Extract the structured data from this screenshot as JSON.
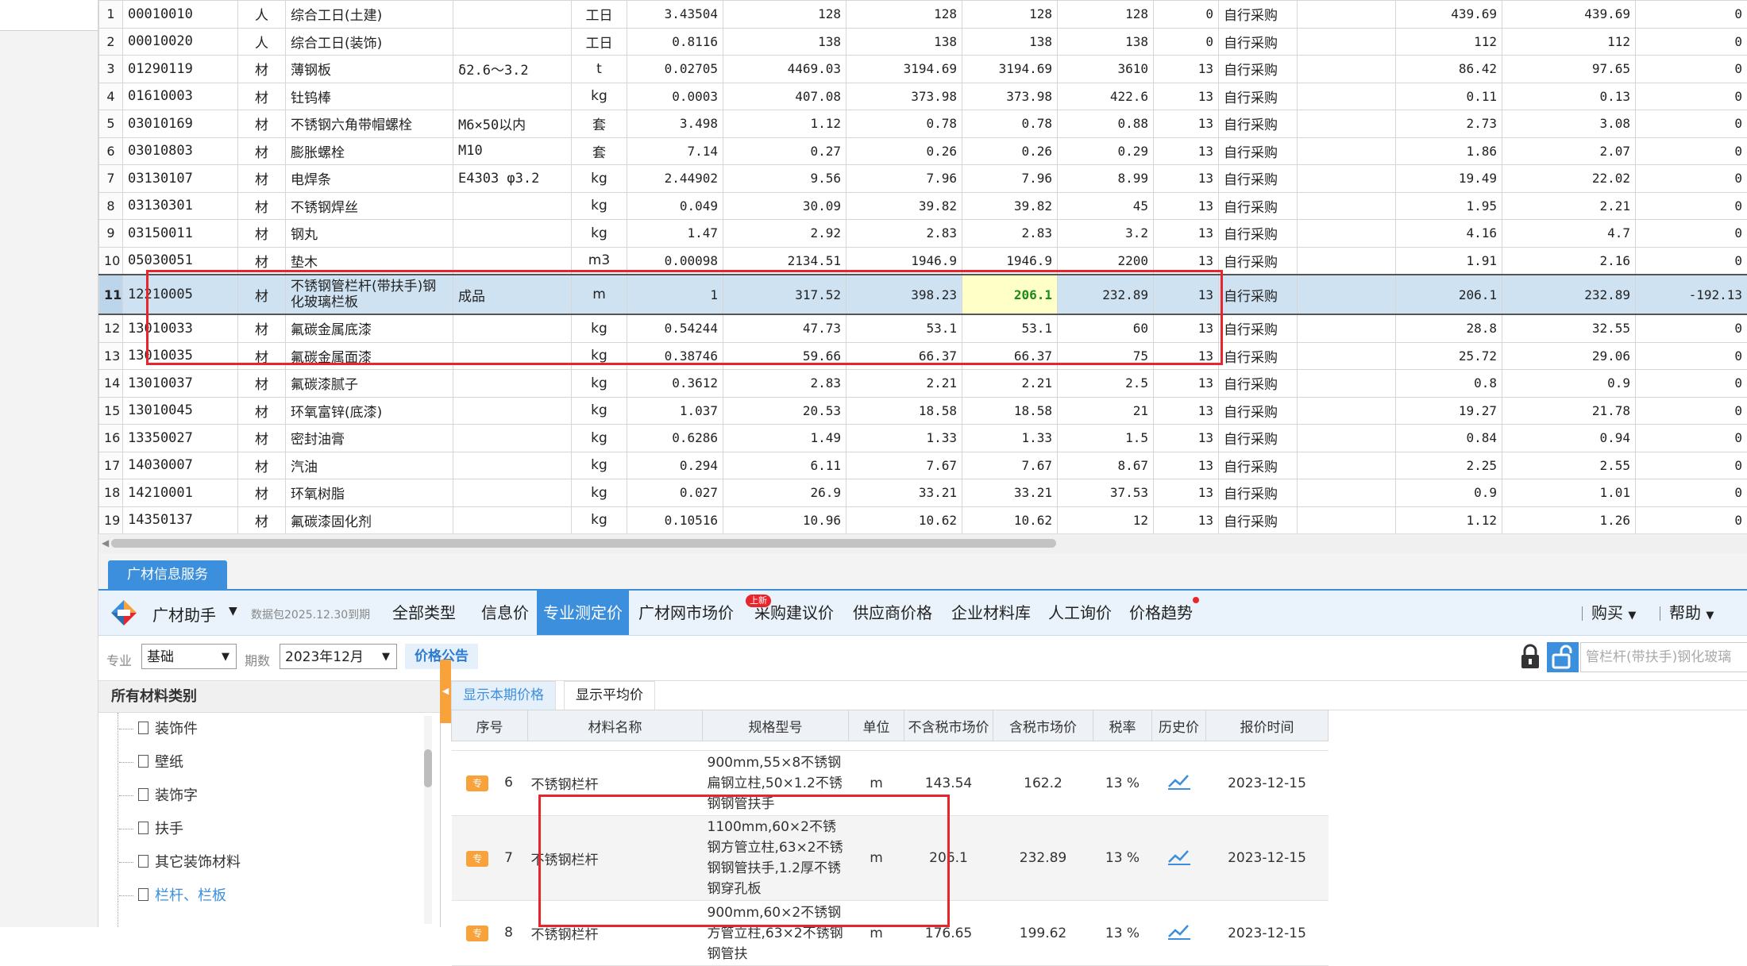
{
  "top_table": {
    "rows": [
      {
        "idx": "1",
        "code": "00010010",
        "type": "人",
        "name": "综合工日(土建)",
        "spec": "",
        "unit": "工日",
        "qty": "3.43504",
        "budget_price": "128",
        "market_price": "128",
        "tax_excl_price": "128",
        "tax_incl_price": "128",
        "tax_rate": "0",
        "supply": "自行采购",
        "extra": "",
        "amount1": "439.69",
        "amount2": "439.69",
        "diff": "0"
      },
      {
        "idx": "2",
        "code": "00010020",
        "type": "人",
        "name": "综合工日(装饰)",
        "spec": "",
        "unit": "工日",
        "qty": "0.8116",
        "budget_price": "138",
        "market_price": "138",
        "tax_excl_price": "138",
        "tax_incl_price": "138",
        "tax_rate": "0",
        "supply": "自行采购",
        "extra": "",
        "amount1": "112",
        "amount2": "112",
        "diff": "0"
      },
      {
        "idx": "3",
        "code": "01290119",
        "type": "材",
        "name": "薄钢板",
        "spec": "δ2.6～3.2",
        "unit": "t",
        "qty": "0.02705",
        "budget_price": "4469.03",
        "market_price": "3194.69",
        "tax_excl_price": "3194.69",
        "tax_incl_price": "3610",
        "tax_rate": "13",
        "supply": "自行采购",
        "extra": "",
        "amount1": "86.42",
        "amount2": "97.65",
        "diff": "0"
      },
      {
        "idx": "4",
        "code": "01610003",
        "type": "材",
        "name": "钍钨棒",
        "spec": "",
        "unit": "kg",
        "qty": "0.0003",
        "budget_price": "407.08",
        "market_price": "373.98",
        "tax_excl_price": "373.98",
        "tax_incl_price": "422.6",
        "tax_rate": "13",
        "supply": "自行采购",
        "extra": "",
        "amount1": "0.11",
        "amount2": "0.13",
        "diff": "0"
      },
      {
        "idx": "5",
        "code": "03010169",
        "type": "材",
        "name": "不锈钢六角带帽螺栓",
        "spec": "M6×50以内",
        "unit": "套",
        "qty": "3.498",
        "budget_price": "1.12",
        "market_price": "0.78",
        "tax_excl_price": "0.78",
        "tax_incl_price": "0.88",
        "tax_rate": "13",
        "supply": "自行采购",
        "extra": "",
        "amount1": "2.73",
        "amount2": "3.08",
        "diff": "0"
      },
      {
        "idx": "6",
        "code": "03010803",
        "type": "材",
        "name": "膨胀螺栓",
        "spec": "M10",
        "unit": "套",
        "qty": "7.14",
        "budget_price": "0.27",
        "market_price": "0.26",
        "tax_excl_price": "0.26",
        "tax_incl_price": "0.29",
        "tax_rate": "13",
        "supply": "自行采购",
        "extra": "",
        "amount1": "1.86",
        "amount2": "2.07",
        "diff": "0"
      },
      {
        "idx": "7",
        "code": "03130107",
        "type": "材",
        "name": "电焊条",
        "spec": "E4303 φ3.2",
        "unit": "kg",
        "qty": "2.44902",
        "budget_price": "9.56",
        "market_price": "7.96",
        "tax_excl_price": "7.96",
        "tax_incl_price": "8.99",
        "tax_rate": "13",
        "supply": "自行采购",
        "extra": "",
        "amount1": "19.49",
        "amount2": "22.02",
        "diff": "0"
      },
      {
        "idx": "8",
        "code": "03130301",
        "type": "材",
        "name": "不锈钢焊丝",
        "spec": "",
        "unit": "kg",
        "qty": "0.049",
        "budget_price": "30.09",
        "market_price": "39.82",
        "tax_excl_price": "39.82",
        "tax_incl_price": "45",
        "tax_rate": "13",
        "supply": "自行采购",
        "extra": "",
        "amount1": "1.95",
        "amount2": "2.21",
        "diff": "0"
      },
      {
        "idx": "9",
        "code": "03150011",
        "type": "材",
        "name": "钢丸",
        "spec": "",
        "unit": "kg",
        "qty": "1.47",
        "budget_price": "2.92",
        "market_price": "2.83",
        "tax_excl_price": "2.83",
        "tax_incl_price": "3.2",
        "tax_rate": "13",
        "supply": "自行采购",
        "extra": "",
        "amount1": "4.16",
        "amount2": "4.7",
        "diff": "0"
      },
      {
        "idx": "10",
        "code": "05030051",
        "type": "材",
        "name": "垫木",
        "spec": "",
        "unit": "m3",
        "qty": "0.00098",
        "budget_price": "2134.51",
        "market_price": "1946.9",
        "tax_excl_price": "1946.9",
        "tax_incl_price": "2200",
        "tax_rate": "13",
        "supply": "自行采购",
        "extra": "",
        "amount1": "1.91",
        "amount2": "2.16",
        "diff": "0"
      },
      {
        "idx": "11",
        "code": "12210005",
        "type": "材",
        "name": "不锈钢管栏杆(带扶手)钢化玻璃栏板",
        "spec": "成品",
        "unit": "m",
        "qty": "1",
        "budget_price": "317.52",
        "market_price": "398.23",
        "tax_excl_price": "206.1",
        "tax_incl_price": "232.89",
        "tax_rate": "13",
        "supply": "自行采购",
        "extra": "",
        "amount1": "206.1",
        "amount2": "232.89",
        "diff": "-192.13",
        "selected": true
      },
      {
        "idx": "12",
        "code": "13010033",
        "type": "材",
        "name": "氟碳金属底漆",
        "spec": "",
        "unit": "kg",
        "qty": "0.54244",
        "budget_price": "47.73",
        "market_price": "53.1",
        "tax_excl_price": "53.1",
        "tax_incl_price": "60",
        "tax_rate": "13",
        "supply": "自行采购",
        "extra": "",
        "amount1": "28.8",
        "amount2": "32.55",
        "diff": "0"
      },
      {
        "idx": "13",
        "code": "13010035",
        "type": "材",
        "name": "氟碳金属面漆",
        "spec": "",
        "unit": "kg",
        "qty": "0.38746",
        "budget_price": "59.66",
        "market_price": "66.37",
        "tax_excl_price": "66.37",
        "tax_incl_price": "75",
        "tax_rate": "13",
        "supply": "自行采购",
        "extra": "",
        "amount1": "25.72",
        "amount2": "29.06",
        "diff": "0"
      },
      {
        "idx": "14",
        "code": "13010037",
        "type": "材",
        "name": "氟碳漆腻子",
        "spec": "",
        "unit": "kg",
        "qty": "0.3612",
        "budget_price": "2.83",
        "market_price": "2.21",
        "tax_excl_price": "2.21",
        "tax_incl_price": "2.5",
        "tax_rate": "13",
        "supply": "自行采购",
        "extra": "",
        "amount1": "0.8",
        "amount2": "0.9",
        "diff": "0"
      },
      {
        "idx": "15",
        "code": "13010045",
        "type": "材",
        "name": "环氧富锌(底漆)",
        "spec": "",
        "unit": "kg",
        "qty": "1.037",
        "budget_price": "20.53",
        "market_price": "18.58",
        "tax_excl_price": "18.58",
        "tax_incl_price": "21",
        "tax_rate": "13",
        "supply": "自行采购",
        "extra": "",
        "amount1": "19.27",
        "amount2": "21.78",
        "diff": "0"
      },
      {
        "idx": "16",
        "code": "13350027",
        "type": "材",
        "name": "密封油膏",
        "spec": "",
        "unit": "kg",
        "qty": "0.6286",
        "budget_price": "1.49",
        "market_price": "1.33",
        "tax_excl_price": "1.33",
        "tax_incl_price": "1.5",
        "tax_rate": "13",
        "supply": "自行采购",
        "extra": "",
        "amount1": "0.84",
        "amount2": "0.94",
        "diff": "0"
      },
      {
        "idx": "17",
        "code": "14030007",
        "type": "材",
        "name": "汽油",
        "spec": "",
        "unit": "kg",
        "qty": "0.294",
        "budget_price": "6.11",
        "market_price": "7.67",
        "tax_excl_price": "7.67",
        "tax_incl_price": "8.67",
        "tax_rate": "13",
        "supply": "自行采购",
        "extra": "",
        "amount1": "2.25",
        "amount2": "2.55",
        "diff": "0"
      },
      {
        "idx": "18",
        "code": "14210001",
        "type": "材",
        "name": "环氧树脂",
        "spec": "",
        "unit": "kg",
        "qty": "0.027",
        "budget_price": "26.9",
        "market_price": "33.21",
        "tax_excl_price": "33.21",
        "tax_incl_price": "37.53",
        "tax_rate": "13",
        "supply": "自行采购",
        "extra": "",
        "amount1": "0.9",
        "amount2": "1.01",
        "diff": "0"
      },
      {
        "idx": "19",
        "code": "14350137",
        "type": "材",
        "name": "氟碳漆固化剂",
        "spec": "",
        "unit": "kg",
        "qty": "0.10516",
        "budget_price": "10.96",
        "market_price": "10.62",
        "tax_excl_price": "10.62",
        "tax_incl_price": "12",
        "tax_rate": "13",
        "supply": "自行采购",
        "extra": "",
        "amount1": "1.12",
        "amount2": "1.26",
        "diff": "0"
      }
    ]
  },
  "service_tab": "广材信息服务",
  "toolbar": {
    "app_name": "广材助手",
    "package_note": "数据包2025.12.30到期",
    "tabs": [
      "全部类型",
      "信息价",
      "专业测定价",
      "广材网市场价",
      "采购建议价",
      "供应商价格",
      "企业材料库",
      "人工询价",
      "价格趋势"
    ],
    "active_tab": "专业测定价",
    "new_badge": "上新",
    "buy": "购买",
    "help": "帮助"
  },
  "filter": {
    "major_label": "专业",
    "major_value": "基础",
    "period_label": "期数",
    "period_value": "2023年12月",
    "notice_button": "价格公告",
    "search_text": "管栏杆(带扶手)钢化玻璃"
  },
  "category": {
    "header": "所有材料类别",
    "items": [
      "装饰件",
      "壁纸",
      "装饰字",
      "扶手",
      "其它装饰材料",
      "栏杆、栏板"
    ],
    "active_item": "栏杆、栏板"
  },
  "price": {
    "tabs": [
      "显示本期价格",
      "显示平均价"
    ],
    "active_tab": "显示本期价格",
    "headers": [
      "序号",
      "材料名称",
      "规格型号",
      "单位",
      "不含税市场价",
      "含税市场价",
      "税率",
      "历史价",
      "报价时间"
    ],
    "badge": "专",
    "rows": [
      {
        "no": "6",
        "name": "不锈钢栏杆",
        "spec": "900mm,55×8不锈钢扁钢立柱,50×1.2不锈钢钢管扶手",
        "unit": "m",
        "price_excl": "143.54",
        "price_incl": "162.2",
        "tax": "13 %",
        "time": "2023-12-15"
      },
      {
        "no": "7",
        "name": "不锈钢栏杆",
        "spec": "1100mm,60×2不锈钢方管立柱,63×2不锈钢钢管扶手,1.2厚不锈钢穿孔板",
        "unit": "m",
        "price_excl": "206.1",
        "price_incl": "232.89",
        "tax": "13 %",
        "time": "2023-12-15"
      },
      {
        "no": "8",
        "name": "不锈钢栏杆",
        "spec": "900mm,60×2不锈钢方管立柱,63×2不锈钢钢管扶",
        "unit": "m",
        "price_excl": "176.65",
        "price_incl": "199.62",
        "tax": "13 %",
        "time": "2023-12-15"
      }
    ]
  },
  "colors": {
    "accent": "#3b8fdc",
    "highlight_red": "#e8242c",
    "selected_row": "#cfe2f1",
    "badge_orange": "#f7a23b"
  }
}
